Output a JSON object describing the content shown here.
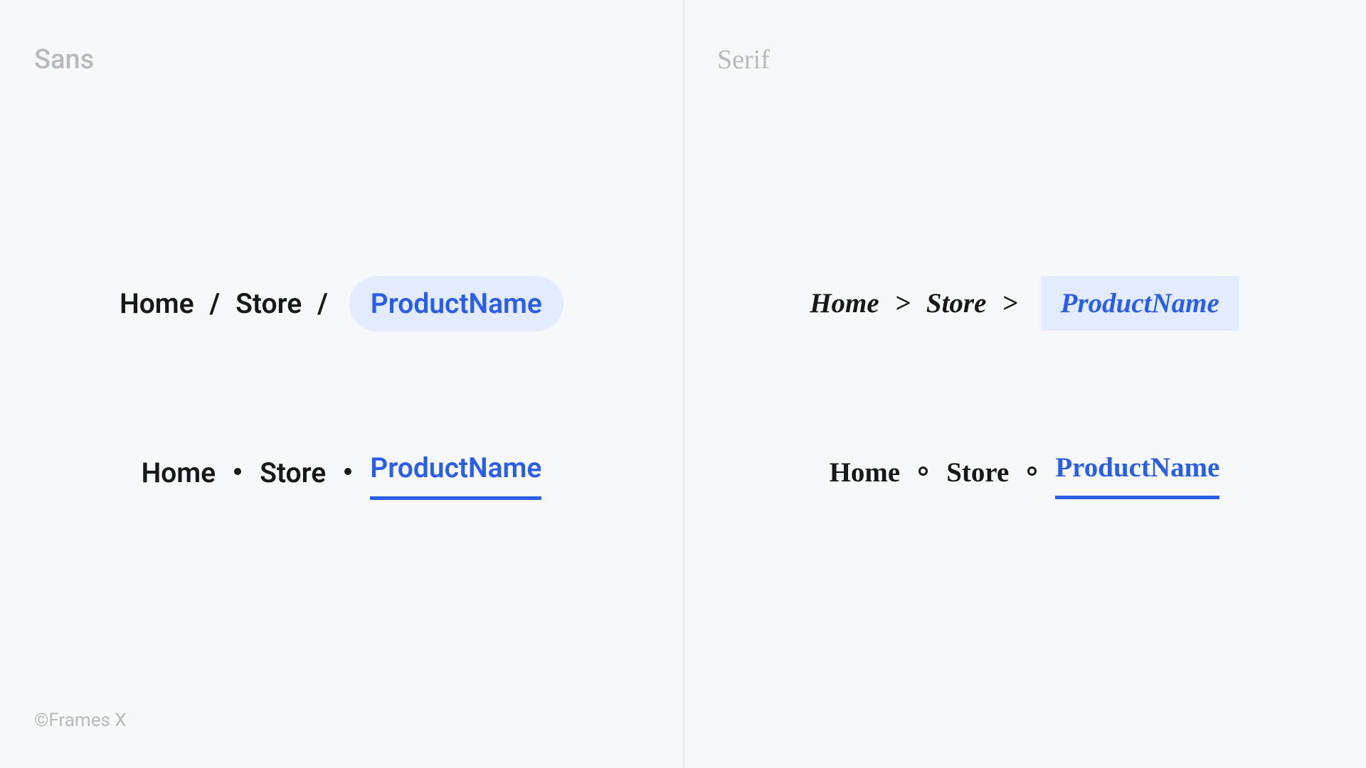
{
  "panels": {
    "left": {
      "title": "Sans"
    },
    "right": {
      "title": "Serif"
    }
  },
  "crumbs": {
    "home": "Home",
    "store": "Store",
    "product": "ProductName"
  },
  "separators": {
    "slash": "/",
    "chevron": ">"
  },
  "footer": "©Frames X",
  "colors": {
    "accent": "#2a5de8",
    "pill_bg": "#e3ebff",
    "text": "#16181d",
    "muted": "#b5b9c0"
  }
}
